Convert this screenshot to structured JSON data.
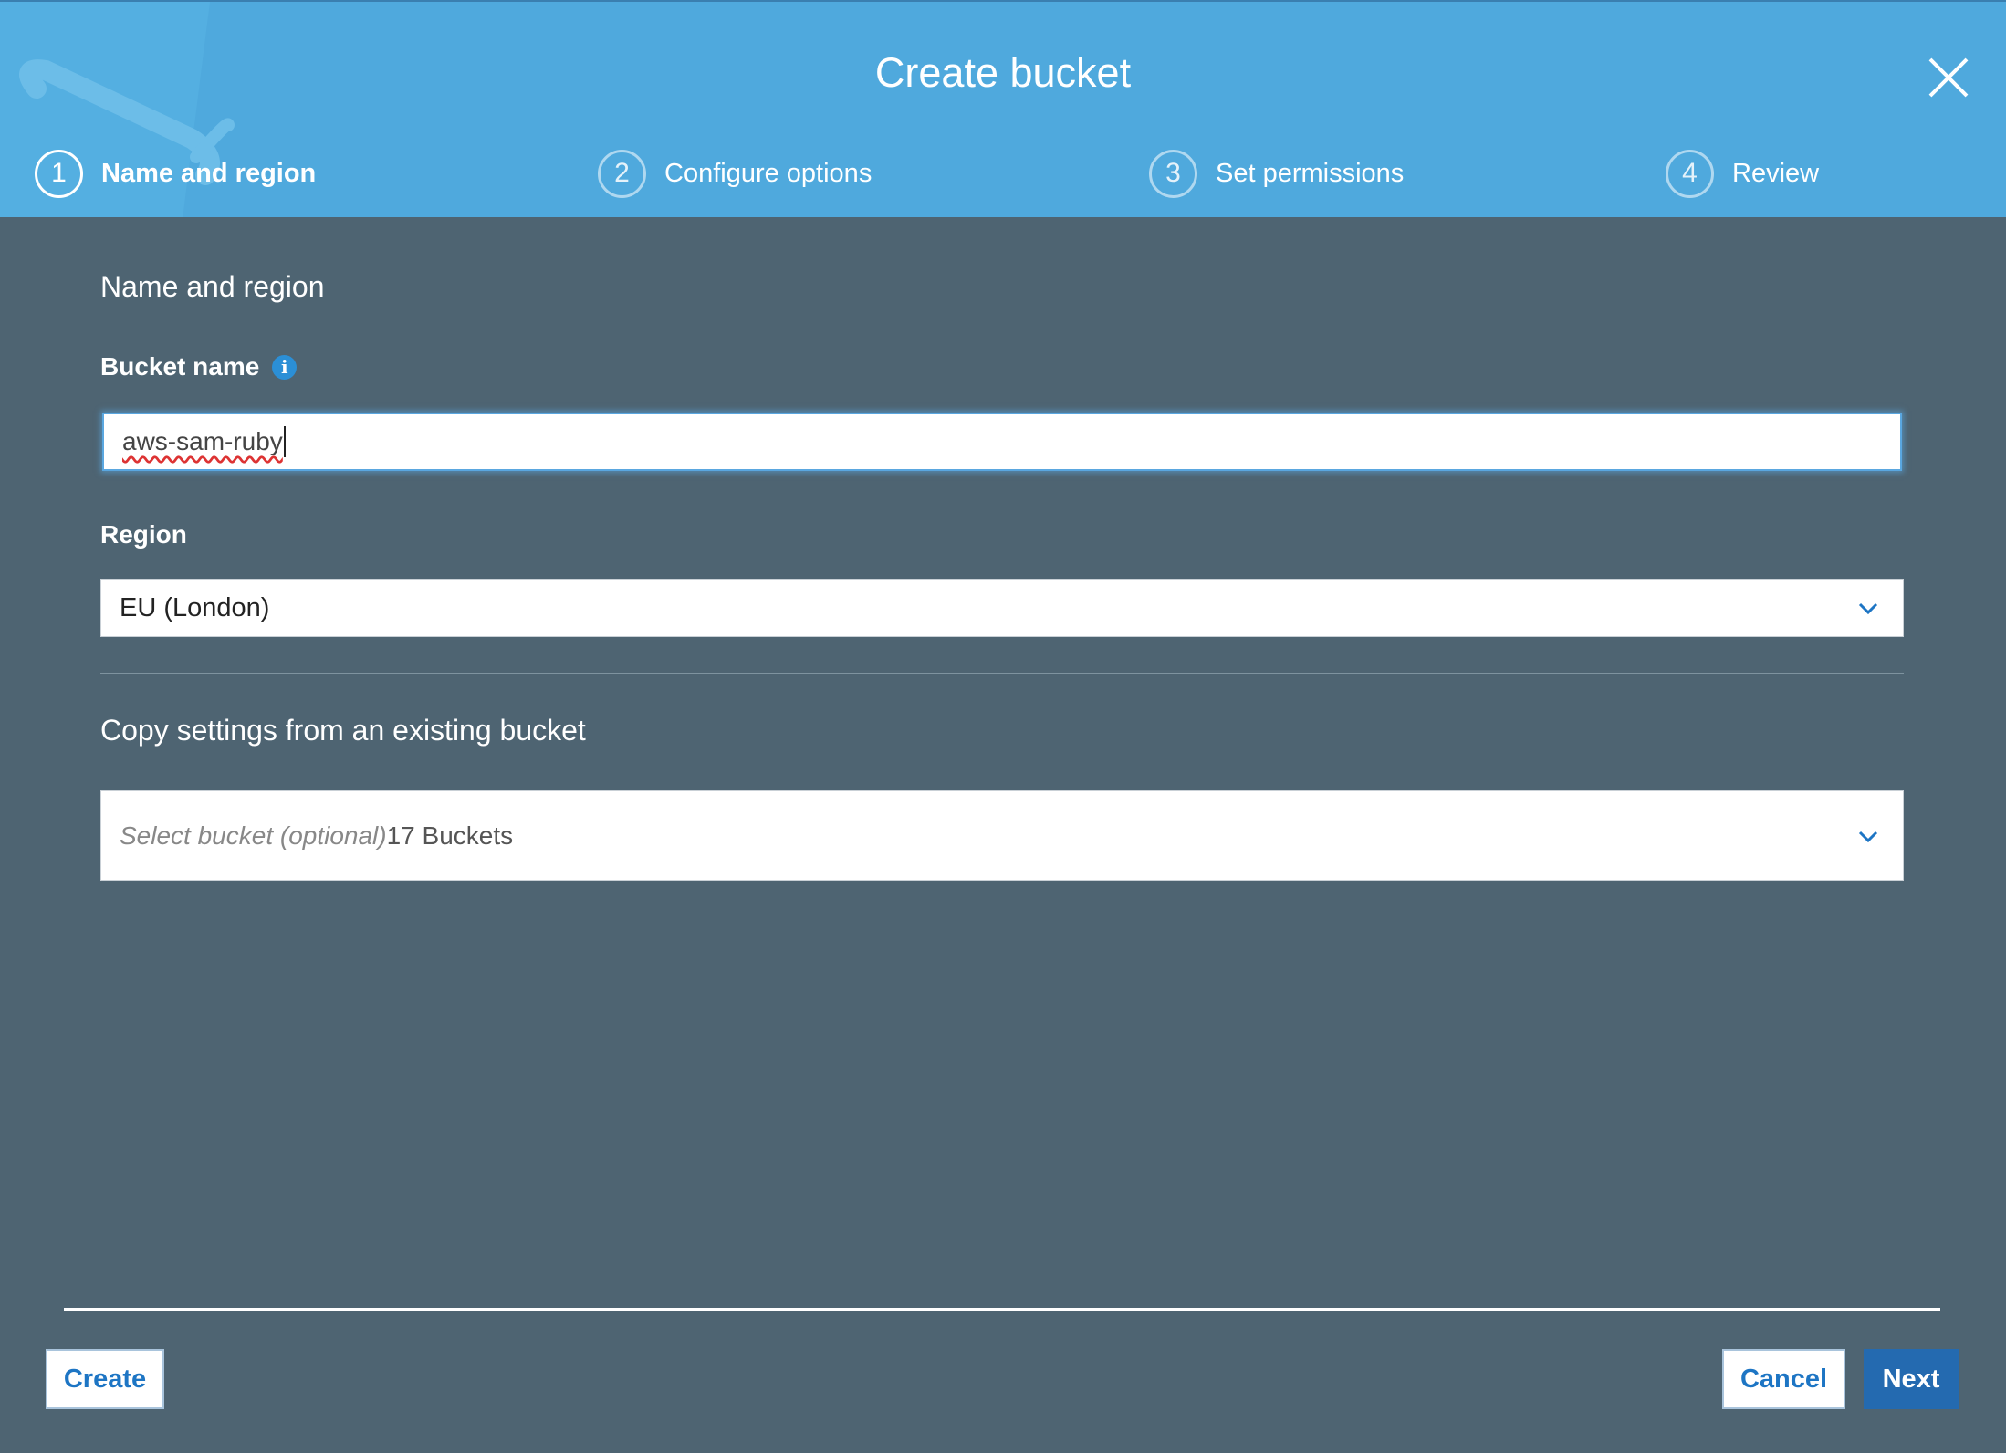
{
  "dialog": {
    "title": "Create bucket",
    "close_icon": "close-icon"
  },
  "steps": [
    {
      "number": "1",
      "label": "Name and region",
      "active": true
    },
    {
      "number": "2",
      "label": "Configure options",
      "active": false
    },
    {
      "number": "3",
      "label": "Set permissions",
      "active": false
    },
    {
      "number": "4",
      "label": "Review",
      "active": false
    }
  ],
  "form": {
    "section_title": "Name and region",
    "bucket_name_label": "Bucket name",
    "info_icon": "info-icon",
    "bucket_name_value": "aws-sam-ruby",
    "region_label": "Region",
    "region_value": "EU (London)",
    "copy_settings_title": "Copy settings from an existing bucket",
    "copy_placeholder": "Select bucket (optional)",
    "copy_count": "17 Buckets"
  },
  "footer": {
    "create_label": "Create",
    "cancel_label": "Cancel",
    "next_label": "Next"
  },
  "colors": {
    "header": "#4fa9dd",
    "body": "#4e6472",
    "primary_button": "#246ab0",
    "link_blue": "#1d75c4"
  }
}
